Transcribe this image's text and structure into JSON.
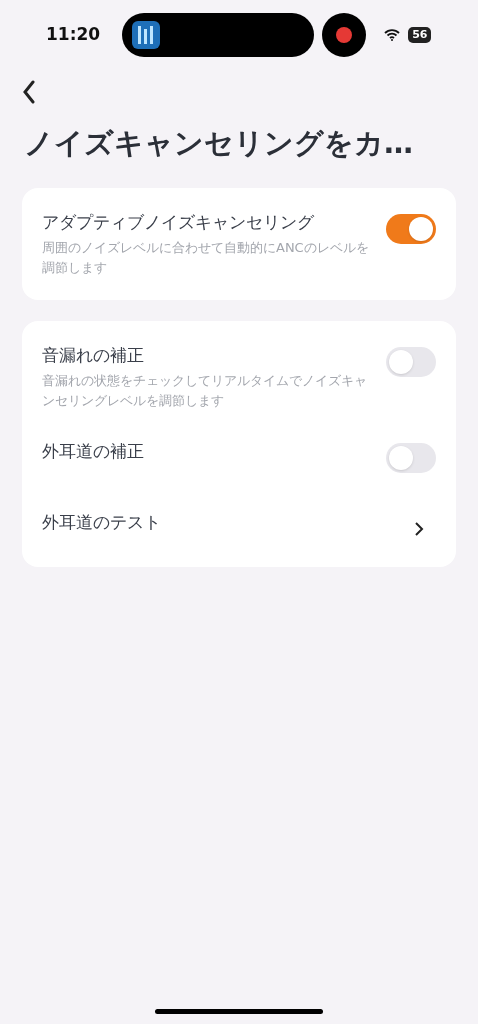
{
  "status_bar": {
    "time": "11:20",
    "battery": "56"
  },
  "title": "ノイズキャンセリングをカ…",
  "cards": [
    {
      "rows": [
        {
          "kind": "toggle",
          "label": "アダプティブノイズキャンセリング",
          "description": "周囲のノイズレベルに合わせて自動的にANCのレベルを調節します",
          "on": true
        }
      ]
    },
    {
      "rows": [
        {
          "kind": "toggle",
          "label": "音漏れの補正",
          "description": "音漏れの状態をチェックしてリアルタイムでノイズキャンセリングレベルを調節します",
          "on": false
        },
        {
          "kind": "toggle",
          "label": "外耳道の補正",
          "on": false
        },
        {
          "kind": "link",
          "label": "外耳道のテスト"
        }
      ]
    }
  ]
}
